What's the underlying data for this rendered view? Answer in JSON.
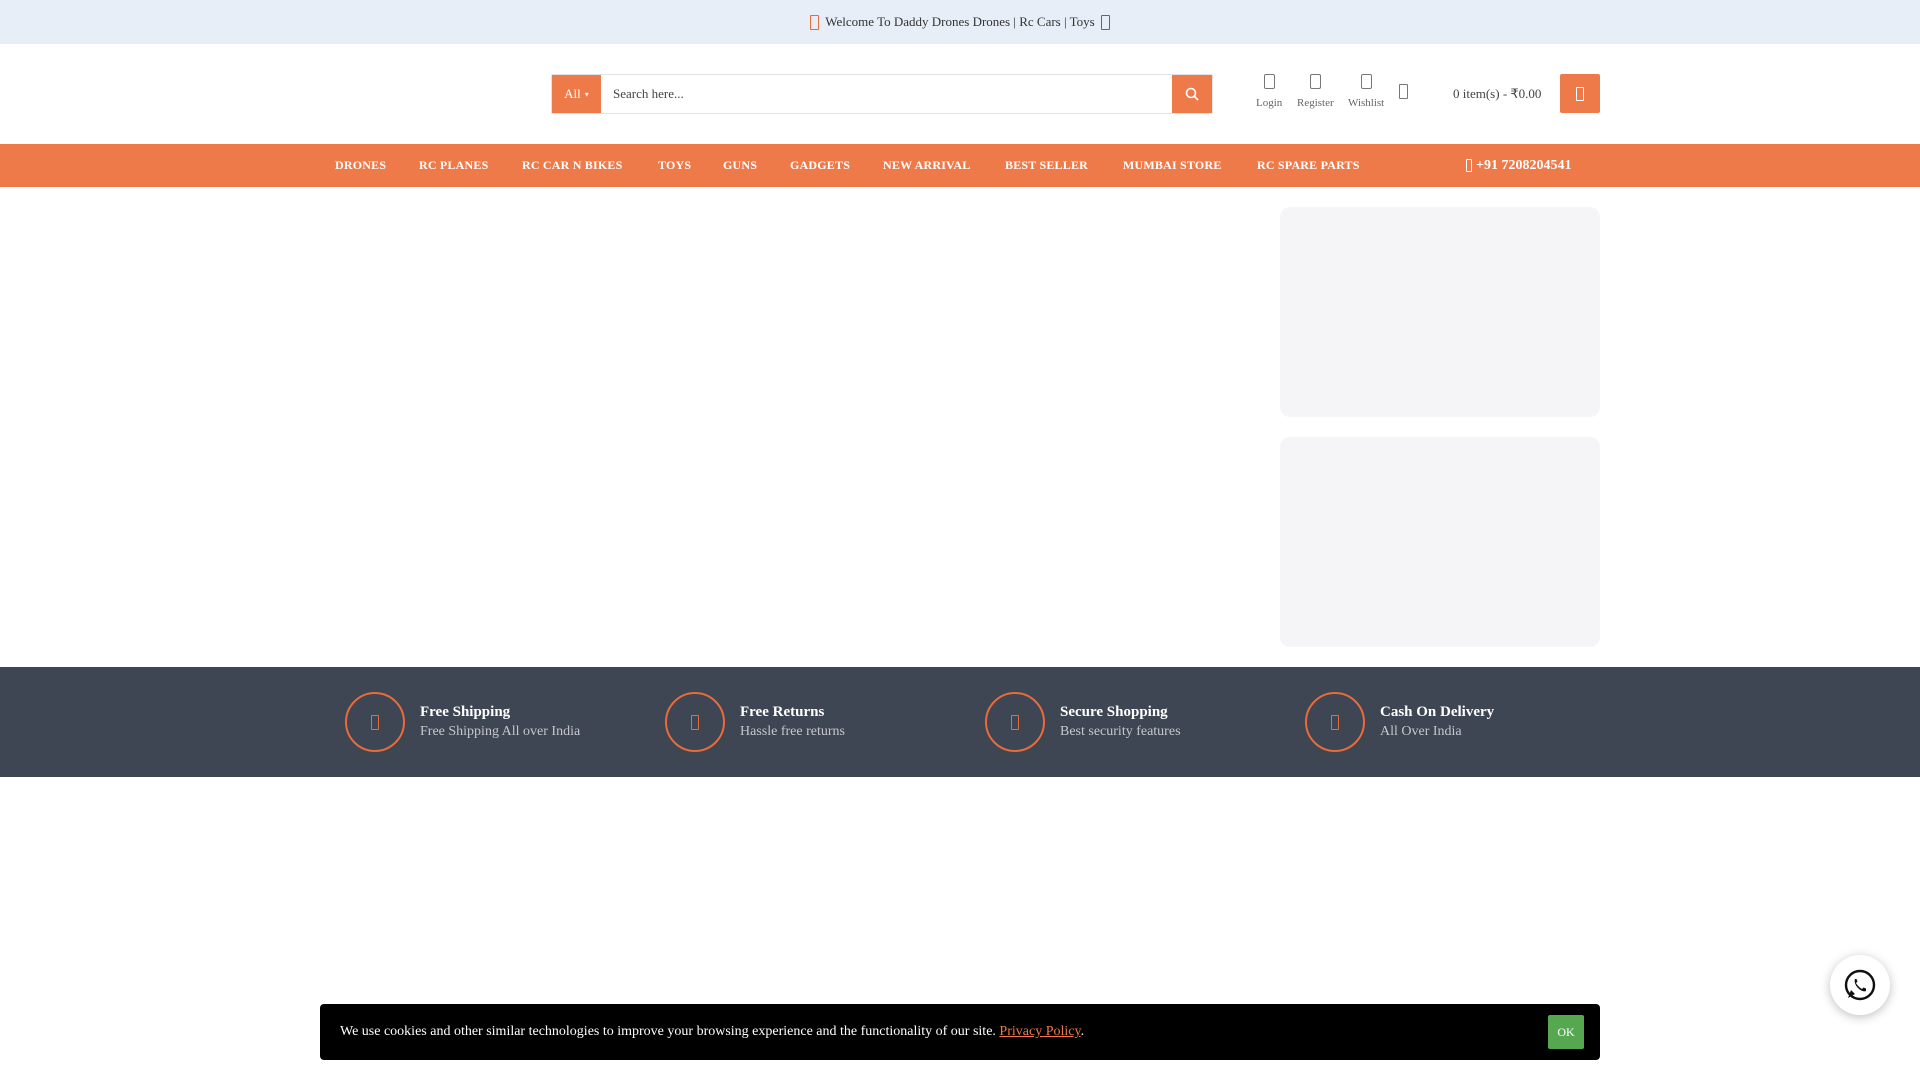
{
  "topbar": {
    "welcome": "Welcome To Daddy Drones Drones | Rc Cars | Toys"
  },
  "search": {
    "category": "All",
    "placeholder": "Search here..."
  },
  "header_links": {
    "login": "Login",
    "register": "Register",
    "wishlist": "Wishlist"
  },
  "cart": {
    "summary": "0 item(s) - ₹0.00"
  },
  "nav": {
    "items": [
      "DRONES",
      "RC PLANES",
      "RC CAR N BIKES",
      "TOYS",
      "GUNS",
      "GADGETS",
      "NEW ARRIVAL",
      "BEST SELLER",
      "MUMBAI STORE",
      "RC SPARE PARTS"
    ],
    "phone": "+91 7208204541"
  },
  "features": [
    {
      "title": "Free Shipping",
      "subtitle": "Free Shipping All over India"
    },
    {
      "title": "Free Returns",
      "subtitle": "Hassle free returns"
    },
    {
      "title": "Secure Shopping",
      "subtitle": "Best security features"
    },
    {
      "title": "Cash On Delivery",
      "subtitle": "All Over India"
    }
  ],
  "cookie": {
    "message": "We use cookies and other similar technologies to improve your browsing experience and the functionality of our site.",
    "link": "Privacy Policy",
    "period": ".",
    "ok": "OK"
  },
  "colors": {
    "accent": "#ee7a4a",
    "topbar": "#e8eef7",
    "features_bg": "#3d4652",
    "ok_button": "#55a84f",
    "whatsapp": "#25d366"
  },
  "icons": {
    "search": "search-icon",
    "cart": "cart-icon",
    "phone": "phone-icon",
    "whatsapp": "whatsapp-icon"
  }
}
